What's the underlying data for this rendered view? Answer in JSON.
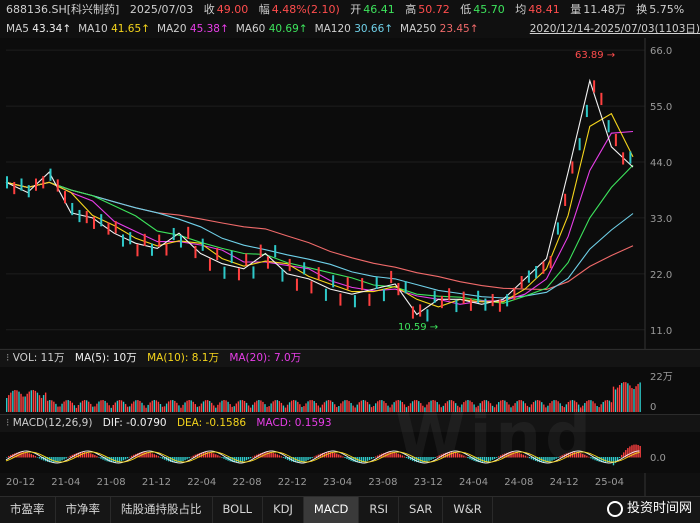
{
  "quote": {
    "code": "688136.SH[科兴制药]",
    "date": "2025/07/03",
    "close_label": "收",
    "close": "49.00",
    "change_label": "幅",
    "change": "4.48%(2.10)",
    "open_label": "开",
    "open": "46.41",
    "high_label": "高",
    "high": "50.72",
    "low_label": "低",
    "low": "45.70",
    "prev_label": "均",
    "prev": "48.41",
    "vol_label": "量",
    "vol": "11.48万",
    "turnover_label": "换",
    "turnover": "5.75%"
  },
  "ma_bar": {
    "items": [
      {
        "name": "MA5",
        "value": "43.34",
        "color": "#f2f2f2"
      },
      {
        "name": "MA10",
        "value": "41.65",
        "color": "#f5d51c"
      },
      {
        "name": "MA20",
        "value": "45.38",
        "color": "#e83ee8"
      },
      {
        "name": "MA60",
        "value": "40.69",
        "color": "#3de35c"
      },
      {
        "name": "MA120",
        "value": "30.66",
        "color": "#6fd0e8"
      },
      {
        "name": "MA250",
        "value": "23.45",
        "color": "#f06a6a"
      }
    ],
    "range": "2020/12/14-2025/07/03(1103日)"
  },
  "price_axis": {
    "labels": [
      "66.0",
      "55.0",
      "44.0",
      "33.0",
      "22.0",
      "11.0"
    ]
  },
  "annotations": {
    "high": "63.89",
    "low": "10.59"
  },
  "vol_panel": {
    "label": "VOL: 11万",
    "ma5": "MA(5): 10万",
    "ma10": "MA(10): 8.1万",
    "ma20": "MA(20): 7.0万",
    "axis_top": "22万",
    "axis_zero": "0"
  },
  "macd_panel": {
    "label": "MACD(12,26,9)",
    "dif": "DIF: -0.0790",
    "dea": "DEA: -0.1586",
    "macd": "MACD: 0.1593",
    "axis_zero": "0.0"
  },
  "x_axis": [
    "20-12",
    "21-04",
    "21-08",
    "21-12",
    "22-04",
    "22-08",
    "22-12",
    "23-04",
    "23-08",
    "23-12",
    "24-04",
    "24-08",
    "24-12",
    "25-04"
  ],
  "tabs": [
    "市盈率",
    "市净率",
    "陆股通持股占比",
    "BOLL",
    "KDJ",
    "MACD",
    "RSI",
    "SAR",
    "W&R"
  ],
  "active_tab": "MACD",
  "brand": "投资时间网",
  "watermark": "Wind",
  "chart_data": {
    "type": "line",
    "x": [
      "20-12",
      "21-02",
      "21-04",
      "21-06",
      "21-08",
      "21-10",
      "21-12",
      "22-02",
      "22-04",
      "22-06",
      "22-08",
      "22-10",
      "22-12",
      "23-02",
      "23-04",
      "23-06",
      "23-08",
      "23-10",
      "23-12",
      "24-02",
      "24-04",
      "24-06",
      "24-08",
      "24-10",
      "24-12",
      "25-02",
      "25-04",
      "25-05",
      "25-06",
      "25-07"
    ],
    "series": [
      {
        "name": "MA5",
        "values": [
          40,
          38,
          42,
          34,
          33,
          30,
          28,
          27,
          30,
          26,
          24,
          23,
          26,
          22,
          21,
          19,
          18,
          19,
          20,
          14,
          17,
          17,
          16,
          17,
          21,
          25,
          42,
          60,
          47,
          43
        ]
      }
    ],
    "ylim": [
      8,
      68
    ]
  }
}
